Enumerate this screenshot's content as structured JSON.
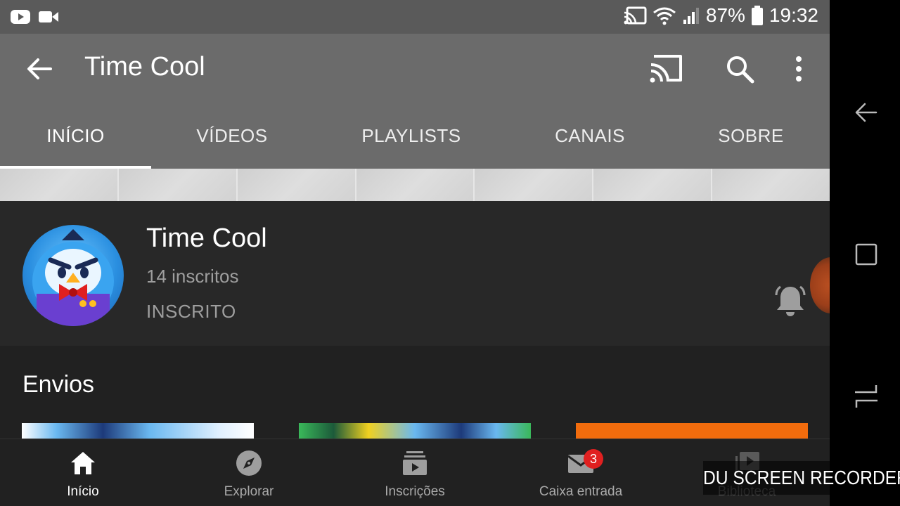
{
  "status_bar": {
    "battery": "87%",
    "time": "19:32"
  },
  "app_bar": {
    "title": "Time Cool"
  },
  "tabs": [
    {
      "label": "INÍCIO",
      "active": true
    },
    {
      "label": "VÍDEOS",
      "active": false
    },
    {
      "label": "PLAYLISTS",
      "active": false
    },
    {
      "label": "CANAIS",
      "active": false
    },
    {
      "label": "SOBRE",
      "active": false
    }
  ],
  "channel": {
    "name": "Time Cool",
    "subscribers": "14 inscritos",
    "subscribed_label": "INSCRITO"
  },
  "section": {
    "title": "Envios"
  },
  "bottom_nav": [
    {
      "label": "Início",
      "icon": "home-icon"
    },
    {
      "label": "Explorar",
      "icon": "compass-icon"
    },
    {
      "label": "Inscrições",
      "icon": "subscriptions-icon"
    },
    {
      "label": "Caixa entrada",
      "icon": "inbox-icon",
      "badge": "3"
    },
    {
      "label": "Biblioteca",
      "icon": "library-icon"
    }
  ],
  "watermark": "DU SCREEN RECORDER",
  "colors": {
    "app_bar": "#6b6b6b",
    "background": "#212121",
    "badge": "#e02020",
    "thumb_orange": "#f26c0d"
  }
}
